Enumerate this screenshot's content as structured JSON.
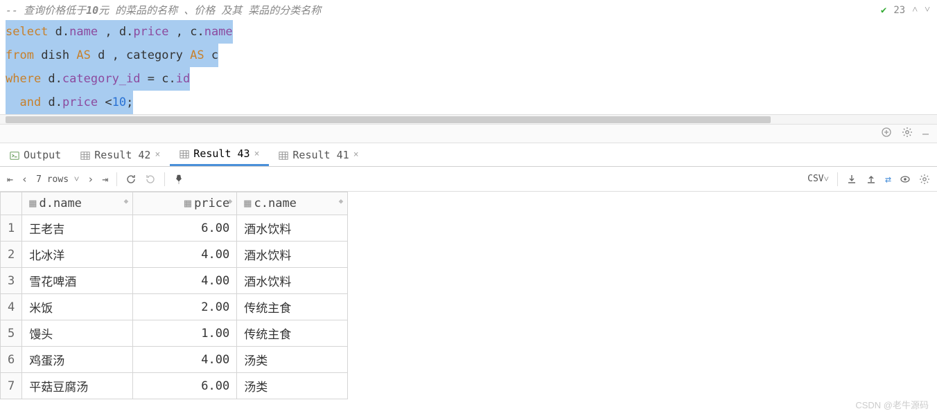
{
  "editor": {
    "comment_prefix": "--",
    "comment_text_a": "查询价格低于 ",
    "comment_num": "10",
    "comment_text_b": "元 的菜品的名称 、价格 及其 菜品的分类名称",
    "status_count": "23",
    "code": {
      "l1": {
        "kw1": "select",
        "p1": " d",
        "dot1": ".",
        "id1": "name",
        "p2": " , d",
        "dot2": ".",
        "id2": "price",
        "p3": " , c",
        "dot3": ".",
        "id3": "name"
      },
      "l2": {
        "kw1": "from",
        "p1": " dish ",
        "kw2": "AS",
        "p2": " d , category ",
        "kw3": "AS",
        "p3": " c"
      },
      "l3": {
        "kw1": "where",
        "p1": " d",
        "dot1": ".",
        "id1": "category_id",
        "p2": " = c",
        "dot2": ".",
        "id2": "id"
      },
      "l4": {
        "p0": "  ",
        "kw1": "and",
        "p1": " d",
        "dot1": ".",
        "id1": "price",
        "p2": " <",
        "num": "10",
        "p3": ";"
      }
    }
  },
  "tabs": {
    "output": "Output",
    "r42": "Result 42",
    "r43": "Result 43",
    "r41": "Result 41"
  },
  "toolbar": {
    "rows": "7 rows",
    "csv": "CSV"
  },
  "table": {
    "cols": {
      "c1": "d.name",
      "c2": "price",
      "c3": "c.name"
    },
    "rows": [
      {
        "n": "1",
        "name": "王老吉",
        "price": "6.00",
        "cat": "酒水饮料"
      },
      {
        "n": "2",
        "name": "北冰洋",
        "price": "4.00",
        "cat": "酒水饮料"
      },
      {
        "n": "3",
        "name": "雪花啤酒",
        "price": "4.00",
        "cat": "酒水饮料"
      },
      {
        "n": "4",
        "name": "米饭",
        "price": "2.00",
        "cat": "传统主食"
      },
      {
        "n": "5",
        "name": "馒头",
        "price": "1.00",
        "cat": "传统主食"
      },
      {
        "n": "6",
        "name": "鸡蛋汤",
        "price": "4.00",
        "cat": "汤类"
      },
      {
        "n": "7",
        "name": "平菇豆腐汤",
        "price": "6.00",
        "cat": "汤类"
      }
    ]
  },
  "watermark": "CSDN @老牛源码"
}
